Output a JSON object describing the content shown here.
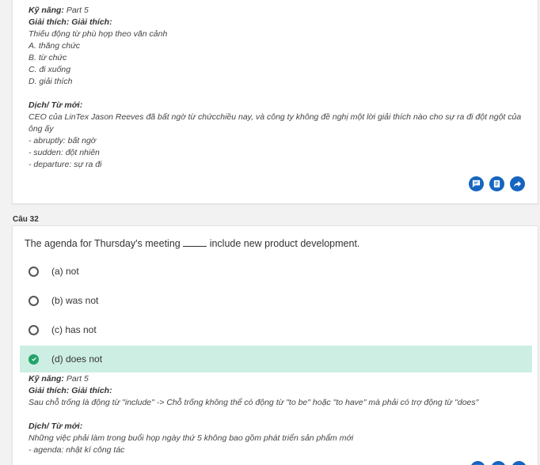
{
  "prev": {
    "skill_label": "Kỹ năng:",
    "skill_value": "Part 5",
    "explain_label": "Giải thích: Giải thích:",
    "explain_lines": [
      "Thiếu động từ phù hợp theo văn cảnh",
      "A. thăng chức",
      "B. từ chức",
      "C. đi xuống",
      "D. giải thích"
    ],
    "translate_label": "Dịch/ Từ mới:",
    "translate_text": "CEO của LinTex Jason Reeves đã bất ngờ từ chứcchiều nay, và công ty không đề nghị một lời giải thích nào cho sự ra đi đột ngột của ông ấy",
    "vocab": [
      "- abruptly: bất ngờ",
      "- sudden: đột nhiên",
      "- departure: sự ra đi"
    ]
  },
  "actions": {
    "comment_icon": "comment-icon",
    "note_icon": "note-icon",
    "share_icon": "share-icon",
    "color": "#1565c0"
  },
  "question": {
    "label": "Câu 32",
    "text_before": "The agenda for Thursday's meeting",
    "text_after": "include new product development.",
    "options": [
      {
        "label": "(a) not",
        "correct": false
      },
      {
        "label": "(b) was not",
        "correct": false
      },
      {
        "label": "(c) has not",
        "correct": false
      },
      {
        "label": "(d) does not",
        "correct": true
      }
    ],
    "correct_color": "#cdeee3",
    "check_color": "#23a36b"
  },
  "explanation": {
    "skill_label": "Kỹ năng:",
    "skill_value": "Part 5",
    "explain_label": "Giải thích: Giải thích:",
    "explain_text": "Sau chỗ trống là động từ \"include\" -> Chỗ trống không thể có động từ \"to be\" hoặc \"to have\" mà phải có trợ động từ \"does\"",
    "translate_label": "Dịch/ Từ mới:",
    "translate_text": "Những việc phải làm trong buổi họp ngày thứ 5 không bao gồm phát triển sản phẩm mới",
    "vocab": [
      "- agenda: nhật kí công tác"
    ]
  }
}
